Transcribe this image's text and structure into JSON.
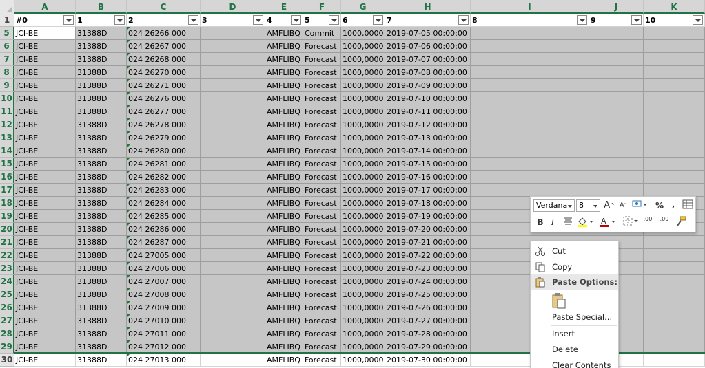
{
  "columns": [
    {
      "letter": "A",
      "header": "#0"
    },
    {
      "letter": "B",
      "header": "1"
    },
    {
      "letter": "C",
      "header": "2"
    },
    {
      "letter": "D",
      "header": "3"
    },
    {
      "letter": "E",
      "header": "4"
    },
    {
      "letter": "F",
      "header": "5"
    },
    {
      "letter": "G",
      "header": "6"
    },
    {
      "letter": "H",
      "header": "7"
    },
    {
      "letter": "I",
      "header": "8"
    },
    {
      "letter": "J",
      "header": "9"
    },
    {
      "letter": "K",
      "header": "10"
    }
  ],
  "header_row_number": "1",
  "rows": [
    {
      "num": "5",
      "a": "JCI-BE",
      "b": "31388D",
      "c": "024 26266 000",
      "e": "AMFLIBQ",
      "f": "Commit",
      "g": "1000,0000",
      "h": "2019-07-05 00:00:00"
    },
    {
      "num": "6",
      "a": "JCI-BE",
      "b": "31388D",
      "c": "024 26267 000",
      "e": "AMFLIBQ",
      "f": "Forecast",
      "g": "1000,0000",
      "h": "2019-07-06 00:00:00"
    },
    {
      "num": "7",
      "a": "JCI-BE",
      "b": "31388D",
      "c": "024 26268 000",
      "e": "AMFLIBQ",
      "f": "Forecast",
      "g": "1000,0000",
      "h": "2019-07-07 00:00:00"
    },
    {
      "num": "8",
      "a": "JCI-BE",
      "b": "31388D",
      "c": "024 26270 000",
      "e": "AMFLIBQ",
      "f": "Forecast",
      "g": "1000,0000",
      "h": "2019-07-08 00:00:00"
    },
    {
      "num": "9",
      "a": "JCI-BE",
      "b": "31388D",
      "c": "024 26271 000",
      "e": "AMFLIBQ",
      "f": "Forecast",
      "g": "1000,0000",
      "h": "2019-07-09 00:00:00"
    },
    {
      "num": "10",
      "a": "JCI-BE",
      "b": "31388D",
      "c": "024 26276 000",
      "e": "AMFLIBQ",
      "f": "Forecast",
      "g": "1000,0000",
      "h": "2019-07-10 00:00:00"
    },
    {
      "num": "11",
      "a": "JCI-BE",
      "b": "31388D",
      "c": "024 26277 000",
      "e": "AMFLIBQ",
      "f": "Forecast",
      "g": "1000,0000",
      "h": "2019-07-11 00:00:00"
    },
    {
      "num": "12",
      "a": "JCI-BE",
      "b": "31388D",
      "c": "024 26278 000",
      "e": "AMFLIBQ",
      "f": "Forecast",
      "g": "1000,0000",
      "h": "2019-07-12 00:00:00"
    },
    {
      "num": "13",
      "a": "JCI-BE",
      "b": "31388D",
      "c": "024 26279 000",
      "e": "AMFLIBQ",
      "f": "Forecast",
      "g": "1000,0000",
      "h": "2019-07-13 00:00:00"
    },
    {
      "num": "14",
      "a": "JCI-BE",
      "b": "31388D",
      "c": "024 26280 000",
      "e": "AMFLIBQ",
      "f": "Forecast",
      "g": "1000,0000",
      "h": "2019-07-14 00:00:00"
    },
    {
      "num": "15",
      "a": "JCI-BE",
      "b": "31388D",
      "c": "024 26281 000",
      "e": "AMFLIBQ",
      "f": "Forecast",
      "g": "1000,0000",
      "h": "2019-07-15 00:00:00"
    },
    {
      "num": "16",
      "a": "JCI-BE",
      "b": "31388D",
      "c": "024 26282 000",
      "e": "AMFLIBQ",
      "f": "Forecast",
      "g": "1000,0000",
      "h": "2019-07-16 00:00:00"
    },
    {
      "num": "17",
      "a": "JCI-BE",
      "b": "31388D",
      "c": "024 26283 000",
      "e": "AMFLIBQ",
      "f": "Forecast",
      "g": "1000,0000",
      "h": "2019-07-17 00:00:00"
    },
    {
      "num": "18",
      "a": "JCI-BE",
      "b": "31388D",
      "c": "024 26284 000",
      "e": "AMFLIBQ",
      "f": "Forecast",
      "g": "1000,0000",
      "h": "2019-07-18 00:00:00"
    },
    {
      "num": "19",
      "a": "JCI-BE",
      "b": "31388D",
      "c": "024 26285 000",
      "e": "AMFLIBQ",
      "f": "Forecast",
      "g": "1000,0000",
      "h": "2019-07-19 00:00:00"
    },
    {
      "num": "20",
      "a": "JCI-BE",
      "b": "31388D",
      "c": "024 26286 000",
      "e": "AMFLIBQ",
      "f": "Forecast",
      "g": "1000,0000",
      "h": "2019-07-20 00:00:00"
    },
    {
      "num": "21",
      "a": "JCI-BE",
      "b": "31388D",
      "c": "024 26287 000",
      "e": "AMFLIBQ",
      "f": "Forecast",
      "g": "1000,0000",
      "h": "2019-07-21 00:00:00"
    },
    {
      "num": "22",
      "a": "JCI-BE",
      "b": "31388D",
      "c": "024 27005 000",
      "e": "AMFLIBQ",
      "f": "Forecast",
      "g": "1000,0000",
      "h": "2019-07-22 00:00:00"
    },
    {
      "num": "23",
      "a": "JCI-BE",
      "b": "31388D",
      "c": "024 27006 000",
      "e": "AMFLIBQ",
      "f": "Forecast",
      "g": "1000,0000",
      "h": "2019-07-23 00:00:00"
    },
    {
      "num": "24",
      "a": "JCI-BE",
      "b": "31388D",
      "c": "024 27007 000",
      "e": "AMFLIBQ",
      "f": "Forecast",
      "g": "1000,0000",
      "h": "2019-07-24 00:00:00"
    },
    {
      "num": "25",
      "a": "JCI-BE",
      "b": "31388D",
      "c": "024 27008 000",
      "e": "AMFLIBQ",
      "f": "Forecast",
      "g": "1000,0000",
      "h": "2019-07-25 00:00:00"
    },
    {
      "num": "26",
      "a": "JCI-BE",
      "b": "31388D",
      "c": "024 27009 000",
      "e": "AMFLIBQ",
      "f": "Forecast",
      "g": "1000,0000",
      "h": "2019-07-26 00:00:00"
    },
    {
      "num": "27",
      "a": "JCI-BE",
      "b": "31388D",
      "c": "024 27010 000",
      "e": "AMFLIBQ",
      "f": "Forecast",
      "g": "1000,0000",
      "h": "2019-07-27 00:00:00"
    },
    {
      "num": "28",
      "a": "JCI-BE",
      "b": "31388D",
      "c": "024 27011 000",
      "e": "AMFLIBQ",
      "f": "Forecast",
      "g": "1000,0000",
      "h": "2019-07-28 00:00:00"
    },
    {
      "num": "29",
      "a": "JCI-BE",
      "b": "31388D",
      "c": "024 27012 000",
      "e": "AMFLIBQ",
      "f": "Forecast",
      "g": "1000,0000",
      "h": "2019-07-29 00:00:00"
    },
    {
      "num": "30",
      "a": "JCI-BE",
      "b": "31388D",
      "c": "024 27013 000",
      "e": "AMFLIBQ",
      "f": "Forecast",
      "g": "1000,0000",
      "h": "2019-07-30 00:00:00"
    }
  ],
  "mini_toolbar": {
    "font_name": "Verdana",
    "font_size": "8",
    "grow_font": "A",
    "shrink_font": "A",
    "percent": "%",
    "comma": ",",
    "bold": "B",
    "italic": "I",
    "increase_decimal": ".00",
    "decrease_decimal": ".00"
  },
  "context_menu": {
    "cut": "Cut",
    "copy": "Copy",
    "paste_options": "Paste Options:",
    "paste_special": "Paste Special...",
    "insert": "Insert",
    "delete": "Delete",
    "clear_contents": "Clear Contents"
  },
  "colors": {
    "excel_green": "#217346",
    "selection_gray": "#c6c6c6",
    "font_red": "#c00000",
    "highlight_yellow": "#ffff00"
  }
}
